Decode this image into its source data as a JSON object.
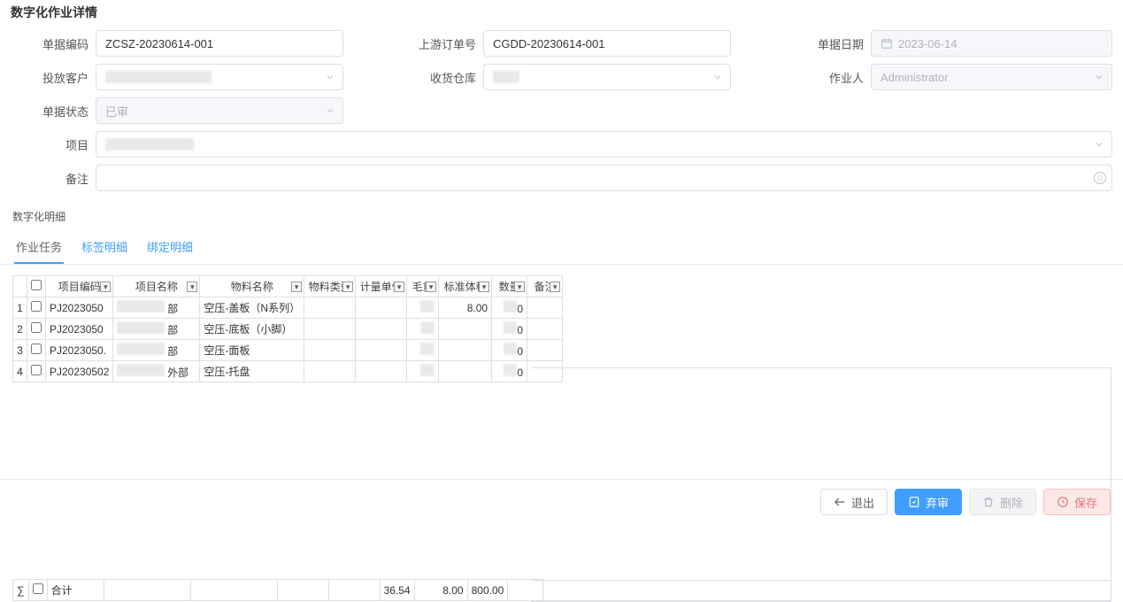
{
  "page": {
    "title": "数字化作业详情",
    "detail_section_title": "数字化明细"
  },
  "form": {
    "doc_code": {
      "label": "单据编码",
      "value": "ZCSZ-20230614-001"
    },
    "upstream_order": {
      "label": "上游订单号",
      "value": "CGDD-20230614-001"
    },
    "doc_date": {
      "label": "单据日期",
      "value": "2023-06-14"
    },
    "customer": {
      "label": "投放客户",
      "value": ""
    },
    "warehouse": {
      "label": "收货仓库",
      "value": ""
    },
    "operator": {
      "label": "作业人",
      "value": "Administrator"
    },
    "status": {
      "label": "单据状态",
      "value": "已审"
    },
    "project": {
      "label": "项目",
      "value": ""
    },
    "remark": {
      "label": "备注",
      "value": ""
    }
  },
  "tabs": [
    "作业任务",
    "标签明细",
    "绑定明细"
  ],
  "columns": {
    "idx": "",
    "chk": "",
    "proj_code": "项目编码",
    "proj_name": "项目名称",
    "mat_name": "物料名称",
    "mat_type": "物料类型",
    "uom": "计量单位",
    "gross": "毛重",
    "std_vol": "标准体积",
    "qty": "数量",
    "remark": "备注"
  },
  "rows": [
    {
      "idx": "1",
      "proj_code": "PJ2023050",
      "proj_name_suffix": "部",
      "mat_name": "空压-盖板（N系列）",
      "std_vol": "8.00",
      "qty_suffix": "0"
    },
    {
      "idx": "2",
      "proj_code": "PJ2023050",
      "proj_name_suffix": "部",
      "mat_name": "空压-底板（小脚）",
      "qty_suffix": "0"
    },
    {
      "idx": "3",
      "proj_code": "PJ2023050.",
      "proj_name_suffix": "部",
      "mat_name": "空压-面板",
      "qty_suffix": "0"
    },
    {
      "idx": "4",
      "proj_code": "PJ20230502",
      "proj_name_suffix": "外部",
      "mat_name": "空压-托盘",
      "qty_suffix": "0"
    }
  ],
  "sum": {
    "sigma": "∑",
    "label": "合计",
    "gross": "36.54",
    "std_vol": "8.00",
    "qty": "800.00"
  },
  "footer": {
    "exit": "退出",
    "abandon": "弃审",
    "delete": "删除",
    "save": "保存"
  }
}
